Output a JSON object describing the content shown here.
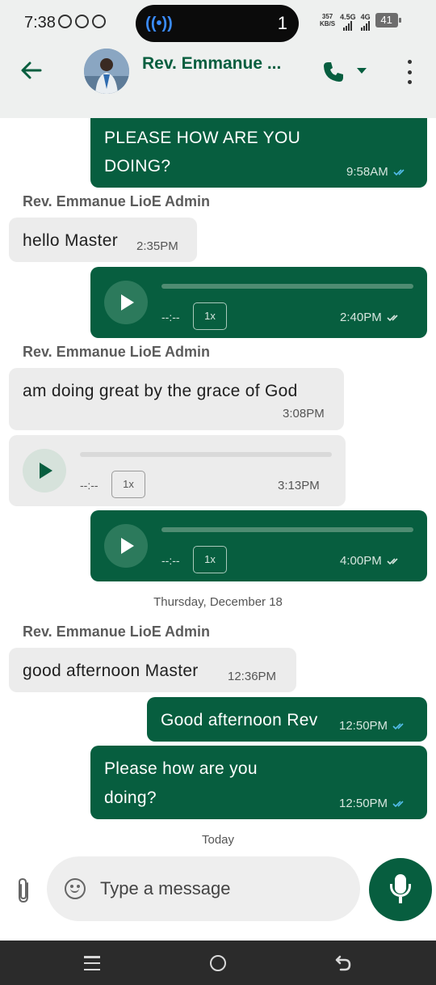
{
  "status_bar": {
    "time": "7:38",
    "notification_count": "1",
    "net_speed_value": "357",
    "net_speed_unit": "KB/S",
    "sim1_label": "4.5G",
    "sim2_label": "4G",
    "battery": "41"
  },
  "header": {
    "contact_name": "Rev. Emmanue ..."
  },
  "messages": [
    {
      "text_line1": "PLEASE HOW ARE YOU",
      "text_line2": "DOING?",
      "time": "9:58AM"
    },
    {
      "sender": "Rev. Emmanue LioE Admin",
      "text": "hello Master",
      "time": "2:35PM"
    },
    {
      "duration": "--:--",
      "speed": "1x",
      "time": "2:40PM"
    },
    {
      "sender": "Rev. Emmanue LioE Admin",
      "text": "am doing great by the grace of God",
      "time": "3:08PM"
    },
    {
      "duration": "--:--",
      "speed": "1x",
      "time": "3:13PM"
    },
    {
      "duration": "--:--",
      "speed": "1x",
      "time": "4:00PM"
    },
    {
      "date_separator": "Thursday, December 18"
    },
    {
      "sender": "Rev. Emmanue LioE Admin",
      "text": "good afternoon Master",
      "time": "12:36PM"
    },
    {
      "text": "Good afternoon Rev",
      "time": "12:50PM"
    },
    {
      "text_line1": "Please how are you",
      "text_line2": "doing?",
      "time": "12:50PM"
    },
    {
      "date_separator": "Today"
    }
  ],
  "composer": {
    "placeholder": "Type a message"
  },
  "colors": {
    "accent": "#075e3f",
    "incoming_bubble": "#ececec",
    "read_tick": "#53bdeb"
  },
  "icons": [
    "back-arrow-icon",
    "phone-icon",
    "more-vert-icon",
    "play-icon",
    "attach-icon",
    "emoji-icon",
    "mic-icon"
  ]
}
